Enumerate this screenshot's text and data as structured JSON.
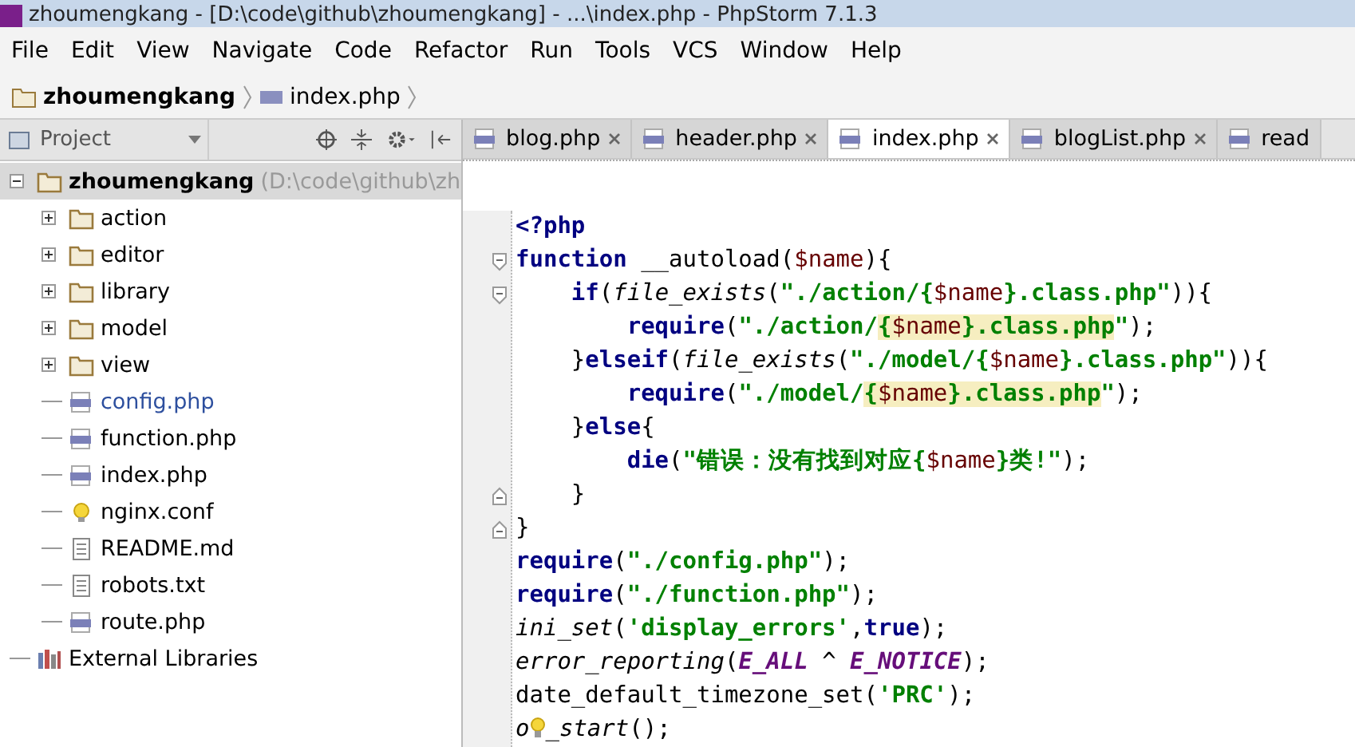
{
  "window": {
    "title": "zhoumengkang - [D:\\code\\github\\zhoumengkang] - ...\\index.php - PhpStorm 7.1.3"
  },
  "menu": [
    "File",
    "Edit",
    "View",
    "Navigate",
    "Code",
    "Refactor",
    "Run",
    "Tools",
    "VCS",
    "Window",
    "Help"
  ],
  "breadcrumb": [
    {
      "label": "zhoumengkang",
      "kind": "folder"
    },
    {
      "label": "index.php",
      "kind": "php"
    }
  ],
  "sidebar": {
    "title": "Project",
    "tree": [
      {
        "label": "zhoumengkang",
        "path": "(D:\\code\\github\\zh",
        "kind": "folder",
        "expanded": true,
        "selected": true,
        "modified": false,
        "children": [
          {
            "label": "action",
            "kind": "folder",
            "expanded": false,
            "selected": false,
            "modified": false
          },
          {
            "label": "editor",
            "kind": "folder",
            "expanded": false,
            "selected": false,
            "modified": false
          },
          {
            "label": "library",
            "kind": "folder",
            "expanded": false,
            "selected": false,
            "modified": false
          },
          {
            "label": "model",
            "kind": "folder",
            "expanded": false,
            "selected": false,
            "modified": false
          },
          {
            "label": "view",
            "kind": "folder",
            "expanded": false,
            "selected": false,
            "modified": false
          },
          {
            "label": "config.php",
            "kind": "php",
            "selected": false,
            "modified": true
          },
          {
            "label": "function.php",
            "kind": "php",
            "selected": false,
            "modified": false
          },
          {
            "label": "index.php",
            "kind": "php",
            "selected": false,
            "modified": false
          },
          {
            "label": "nginx.conf",
            "kind": "config",
            "selected": false,
            "modified": false
          },
          {
            "label": "README.md",
            "kind": "text",
            "selected": false,
            "modified": false
          },
          {
            "label": "robots.txt",
            "kind": "text",
            "selected": false,
            "modified": false
          },
          {
            "label": "route.php",
            "kind": "php",
            "selected": false,
            "modified": false
          }
        ]
      },
      {
        "label": "External Libraries",
        "kind": "library",
        "selected": false,
        "modified": false
      }
    ]
  },
  "tabs": [
    {
      "label": "blog.php",
      "selected": false
    },
    {
      "label": "header.php",
      "selected": false
    },
    {
      "label": "index.php",
      "selected": true
    },
    {
      "label": "blogList.php",
      "selected": false
    },
    {
      "label": "read",
      "selected": false
    }
  ],
  "editor": {
    "lines": [
      {
        "fold_start": false,
        "fold_end": false,
        "tokens": [
          {
            "kind": "keyword",
            "text": "<?php"
          }
        ]
      },
      {
        "fold_start": true,
        "fold_end": false,
        "tokens": [
          {
            "kind": "keyword",
            "text": "function"
          },
          {
            "kind": "plain",
            "text": " __autoload("
          },
          {
            "kind": "variable",
            "text": "$name"
          },
          {
            "kind": "plain",
            "text": "){"
          }
        ]
      },
      {
        "fold_start": true,
        "fold_end": false,
        "tokens": [
          {
            "kind": "keyword",
            "text": "    if"
          },
          {
            "kind": "plain",
            "text": "("
          },
          {
            "kind": "italic",
            "text": "file_exists"
          },
          {
            "kind": "plain",
            "text": "("
          },
          {
            "kind": "string",
            "text": "\"./action/{"
          },
          {
            "kind": "variable",
            "text": "$name"
          },
          {
            "kind": "string",
            "text": "}.class.php\""
          },
          {
            "kind": "plain",
            "text": ")){"
          }
        ]
      },
      {
        "fold_start": false,
        "fold_end": false,
        "tokens": [
          {
            "kind": "keyword",
            "text": "        require"
          },
          {
            "kind": "plain",
            "text": "("
          },
          {
            "kind": "string",
            "text": "\"./action/"
          },
          {
            "kind": "highlight",
            "text": "{"
          },
          {
            "kind": "highvar",
            "text": "$name"
          },
          {
            "kind": "highlight",
            "text": "}.class.php"
          },
          {
            "kind": "string",
            "text": "\""
          },
          {
            "kind": "plain",
            "text": ");"
          }
        ]
      },
      {
        "fold_start": false,
        "fold_end": false,
        "tokens": [
          {
            "kind": "plain",
            "text": "    }"
          },
          {
            "kind": "keyword",
            "text": "elseif"
          },
          {
            "kind": "plain",
            "text": "("
          },
          {
            "kind": "italic",
            "text": "file_exists"
          },
          {
            "kind": "plain",
            "text": "("
          },
          {
            "kind": "string",
            "text": "\"./model/{"
          },
          {
            "kind": "variable",
            "text": "$name"
          },
          {
            "kind": "string",
            "text": "}.class.php\""
          },
          {
            "kind": "plain",
            "text": ")){"
          }
        ]
      },
      {
        "fold_start": false,
        "fold_end": false,
        "tokens": [
          {
            "kind": "keyword",
            "text": "        require"
          },
          {
            "kind": "plain",
            "text": "("
          },
          {
            "kind": "string",
            "text": "\"./model/"
          },
          {
            "kind": "highlight",
            "text": "{"
          },
          {
            "kind": "highvar",
            "text": "$name"
          },
          {
            "kind": "highlight",
            "text": "}.class.php"
          },
          {
            "kind": "string",
            "text": "\""
          },
          {
            "kind": "plain",
            "text": ");"
          }
        ]
      },
      {
        "fold_start": false,
        "fold_end": false,
        "tokens": [
          {
            "kind": "plain",
            "text": "    }"
          },
          {
            "kind": "keyword",
            "text": "else"
          },
          {
            "kind": "plain",
            "text": "{"
          }
        ]
      },
      {
        "fold_start": false,
        "fold_end": false,
        "tokens": [
          {
            "kind": "keyword",
            "text": "        die"
          },
          {
            "kind": "plain",
            "text": "("
          },
          {
            "kind": "string",
            "text": "\"错误：没有找到对应{"
          },
          {
            "kind": "variable",
            "text": "$name"
          },
          {
            "kind": "string",
            "text": "}类!\""
          },
          {
            "kind": "plain",
            "text": ");"
          }
        ]
      },
      {
        "fold_start": false,
        "fold_end": true,
        "tokens": [
          {
            "kind": "plain",
            "text": "    }"
          }
        ]
      },
      {
        "fold_start": false,
        "fold_end": true,
        "tokens": [
          {
            "kind": "plain",
            "text": "}"
          }
        ]
      },
      {
        "fold_start": false,
        "fold_end": false,
        "tokens": [
          {
            "kind": "keyword",
            "text": "require"
          },
          {
            "kind": "plain",
            "text": "("
          },
          {
            "kind": "string",
            "text": "\"./config.php\""
          },
          {
            "kind": "plain",
            "text": ");"
          }
        ]
      },
      {
        "fold_start": false,
        "fold_end": false,
        "tokens": [
          {
            "kind": "keyword",
            "text": "require"
          },
          {
            "kind": "plain",
            "text": "("
          },
          {
            "kind": "string",
            "text": "\"./function.php\""
          },
          {
            "kind": "plain",
            "text": ");"
          }
        ]
      },
      {
        "fold_start": false,
        "fold_end": false,
        "tokens": [
          {
            "kind": "italic",
            "text": "ini_set"
          },
          {
            "kind": "plain",
            "text": "("
          },
          {
            "kind": "string",
            "text": "'display_errors'"
          },
          {
            "kind": "plain",
            "text": ","
          },
          {
            "kind": "keyword",
            "text": "true"
          },
          {
            "kind": "plain",
            "text": ");"
          }
        ]
      },
      {
        "fold_start": false,
        "fold_end": false,
        "tokens": [
          {
            "kind": "italic",
            "text": "error_reporting"
          },
          {
            "kind": "plain",
            "text": "("
          },
          {
            "kind": "constant",
            "text": "E_ALL"
          },
          {
            "kind": "plain",
            "text": " ^ "
          },
          {
            "kind": "constant",
            "text": "E_NOTICE"
          },
          {
            "kind": "plain",
            "text": ");"
          }
        ]
      },
      {
        "fold_start": false,
        "fold_end": false,
        "tokens": [
          {
            "kind": "plain",
            "text": "date_default_timezone_set("
          },
          {
            "kind": "string",
            "text": "'PRC'"
          },
          {
            "kind": "plain",
            "text": ");"
          }
        ]
      },
      {
        "fold_start": false,
        "fold_end": false,
        "tokens": [
          {
            "kind": "italic",
            "text": "o"
          },
          {
            "kind": "bulb"
          },
          {
            "kind": "italic",
            "text": "_start"
          },
          {
            "kind": "plain",
            "text": "();"
          }
        ]
      }
    ]
  }
}
